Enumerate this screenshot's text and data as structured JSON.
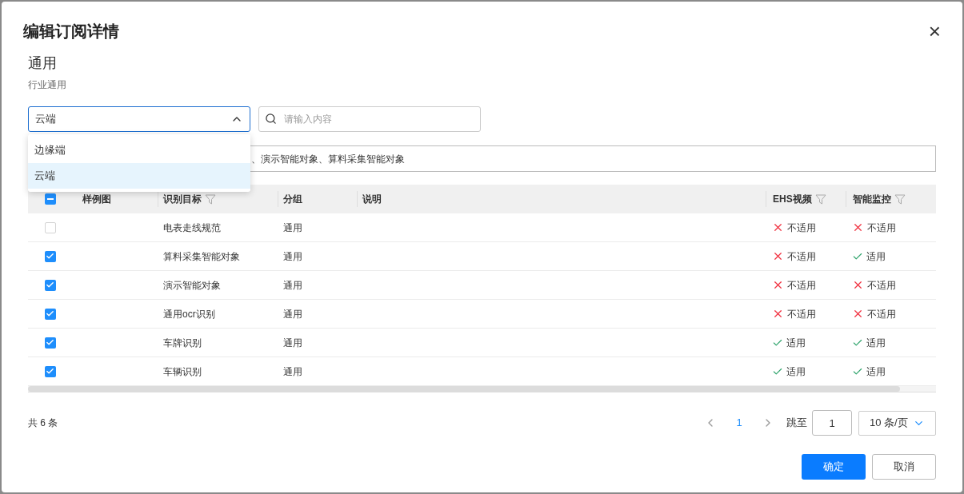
{
  "dialog": {
    "title": "编辑订阅详情",
    "close": "×"
  },
  "section": {
    "title": "通用",
    "subtitle": "行业通用"
  },
  "select": {
    "value": "云端",
    "expanded": true,
    "options": [
      {
        "label": "边缘端",
        "selected": false
      },
      {
        "label": "云端",
        "selected": true
      }
    ]
  },
  "search": {
    "placeholder": "请输入内容"
  },
  "selected_summary": "、演示智能对象、算料采集智能对象",
  "table": {
    "header_indeterminate": true,
    "columns": [
      {
        "label": "样例图",
        "filter": false
      },
      {
        "label": "识别目标",
        "filter": true
      },
      {
        "label": "分组",
        "filter": false
      },
      {
        "label": "说明",
        "filter": false
      },
      {
        "label": "EHS视频",
        "filter": true
      },
      {
        "label": "智能监控",
        "filter": true
      }
    ],
    "rows": [
      {
        "checked": false,
        "target": "电表走线规范",
        "group": "通用",
        "ehs": {
          "ok": false,
          "text": "不适用"
        },
        "monitor": {
          "ok": false,
          "text": "不适用"
        }
      },
      {
        "checked": true,
        "target": "算料采集智能对象",
        "group": "通用",
        "ehs": {
          "ok": false,
          "text": "不适用"
        },
        "monitor": {
          "ok": true,
          "text": "适用"
        }
      },
      {
        "checked": true,
        "target": "演示智能对象",
        "group": "通用",
        "ehs": {
          "ok": false,
          "text": "不适用"
        },
        "monitor": {
          "ok": false,
          "text": "不适用"
        }
      },
      {
        "checked": true,
        "target": "通用ocr识别",
        "group": "通用",
        "ehs": {
          "ok": false,
          "text": "不适用"
        },
        "monitor": {
          "ok": false,
          "text": "不适用"
        }
      },
      {
        "checked": true,
        "target": "车牌识别",
        "group": "通用",
        "ehs": {
          "ok": true,
          "text": "适用"
        },
        "monitor": {
          "ok": true,
          "text": "适用"
        }
      },
      {
        "checked": true,
        "target": "车辆识别",
        "group": "通用",
        "ehs": {
          "ok": true,
          "text": "适用"
        },
        "monitor": {
          "ok": true,
          "text": "适用"
        }
      }
    ]
  },
  "pagination": {
    "total": "共 6 条",
    "pages": [
      {
        "label": "1",
        "selected": true
      }
    ],
    "jump_label": "跳至",
    "jump_value": "1",
    "page_size": "10 条/页"
  },
  "buttons": [
    {
      "label": "确定",
      "kind": "primary"
    },
    {
      "label": "取消",
      "kind": "secondary"
    }
  ]
}
